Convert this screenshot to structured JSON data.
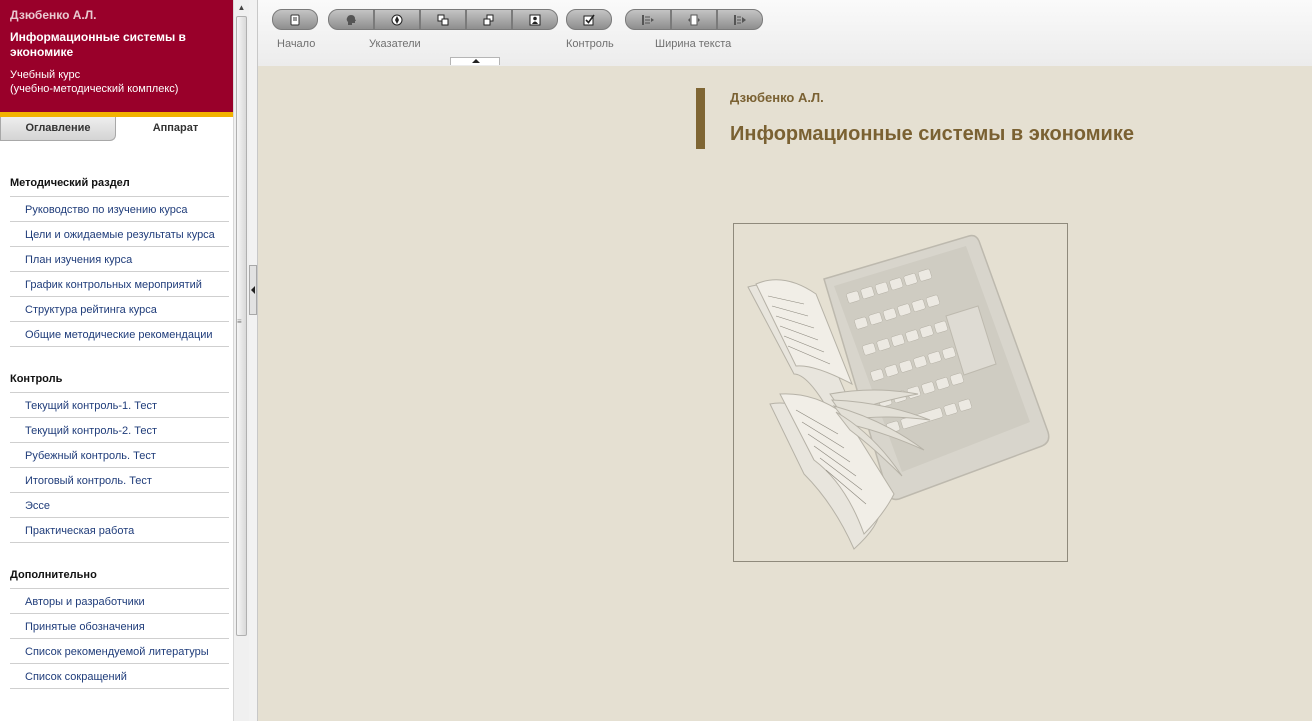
{
  "sidebar": {
    "author": "Дзюбенко А.Л.",
    "course_title": "Информационные системы в экономике",
    "course_subtitle": "Учебный курс\n(учебно-методический комплекс)",
    "tabs": [
      {
        "label": "Оглавление"
      },
      {
        "label": "Аппарат"
      }
    ],
    "sections": [
      {
        "title": "Методический раздел",
        "items": [
          "Руководство по изучению курса",
          "Цели и ожидаемые результаты курса",
          "План изучения курса",
          "График контрольных мероприятий",
          "Структура рейтинга курса",
          "Общие методические рекомендации"
        ]
      },
      {
        "title": "Контроль",
        "items": [
          "Текущий контроль-1. Тест",
          "Текущий контроль-2. Тест",
          "Рубежный контроль. Тест",
          "Итоговый контроль. Тест",
          "Эссе",
          "Практическая работа"
        ]
      },
      {
        "title": "Дополнительно",
        "items": [
          "Авторы и разработчики",
          "Принятые обозначения",
          "Список рекомендуемой литературы",
          "Список сокращений"
        ]
      }
    ]
  },
  "toolbar": {
    "home_label": "Начало",
    "pointers_label": "Указатели",
    "control_label": "Контроль",
    "width_label": "Ширина текста",
    "pointer_icons": [
      "head-icon",
      "compass-icon",
      "copy-icon",
      "duplicate-icon",
      "person-icon"
    ],
    "width_icons": [
      "narrow-text-icon",
      "medium-text-icon",
      "wide-text-icon"
    ]
  },
  "content": {
    "author": "Дзюбенко А.Л.",
    "title": "Информационные системы в экономике",
    "cover_image": "book-laptop-illustration"
  },
  "colors": {
    "sidebar_header": "#99002a",
    "accent_stripe": "#f2b200",
    "content_bg": "#e5e0d2",
    "title_color": "#7a6132"
  }
}
